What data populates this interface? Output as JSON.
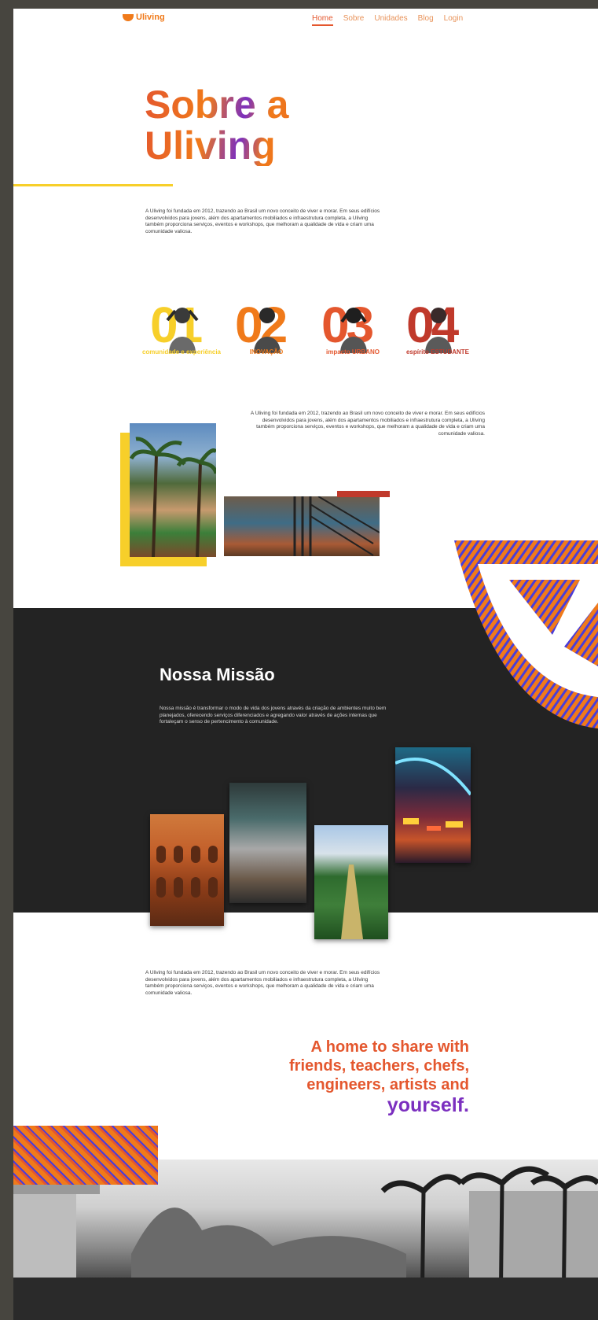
{
  "nav": {
    "logo": "Uliving",
    "items": [
      "Home",
      "Sobre",
      "Unidades",
      "Blog",
      "Login"
    ]
  },
  "hero": {
    "title_line1": "Sobre a",
    "title_line2": "Uliving",
    "intro": "A Uliving foi fundada em 2012, trazendo ao Brasil um novo conceito de viver e morar. Em seus edifícios desenvolvidos para jovens, além dos apartamentos mobiliados e infraestrutura completa, a Uliving também proporciona serviços, eventos e workshops, que melhoram a qualidade de vida e criam uma comunidade valiosa."
  },
  "values": [
    {
      "num": "01",
      "label": "comunidade e experiência",
      "color": "#f7cf2a"
    },
    {
      "num": "02",
      "label": "INOVAÇÃO",
      "color": "#f07a1a"
    },
    {
      "num": "03",
      "label": "impacto URBANO",
      "color": "#e4572e"
    },
    {
      "num": "04",
      "label": "espírito ESTUDANTE",
      "color": "#c0392b"
    }
  ],
  "about2": "A Uliving foi fundada em 2012, trazendo ao Brasil um novo conceito de viver e morar. Em seus edifícios desenvolvidos para jovens, além dos apartamentos mobiliados e infraestrutura completa, a Uliving também proporciona serviços, eventos e workshops, que melhoram a qualidade de vida e criam uma comunidade valiosa.",
  "mission": {
    "title": "Nossa Missão",
    "text": "Nossa missão é transformar o modo de vida dos jovens através da criação de ambientes muito bem planejados, oferecendo serviços diferenciados e agregando valor através de ações internas que fortaleçam o senso de pertencimento à comunidade."
  },
  "lower": {
    "text": "A Uliving foi fundada em 2012, trazendo ao Brasil um novo conceito de viver e morar. Em seus edifícios desenvolvidos para jovens, além dos apartamentos mobiliados e infraestrutura completa, a Uliving também proporciona serviços, eventos e workshops, que melhoram a qualidade de vida e criam uma comunidade valiosa.",
    "tagline_line1": "A home to share with",
    "tagline_line2": "friends, teachers, chefs,",
    "tagline_line3": "engineers, artists and",
    "tagline_line4": "yourself."
  },
  "colors": {
    "orange": "#f07a1a",
    "red_orange": "#e4572e",
    "purple": "#7b2fbf",
    "yellow": "#f7cf2a",
    "dark": "#232323"
  }
}
